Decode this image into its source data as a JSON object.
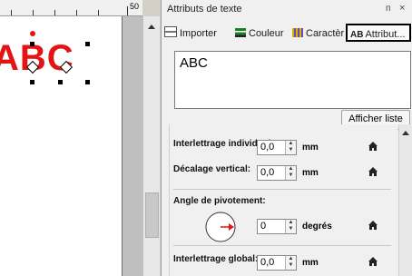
{
  "ruler": {
    "label": "50"
  },
  "canvas": {
    "text": "ABC",
    "text_color": "#e31414"
  },
  "panel": {
    "title": "Attributs de texte",
    "pin_icon": "pin-icon",
    "close_icon": "close-icon",
    "tabs": [
      {
        "label": "Importer",
        "icon": "import-icon"
      },
      {
        "label": "Couleur",
        "icon": "color-icon"
      },
      {
        "label": "Caractèr",
        "icon": "character-icon"
      },
      {
        "label": "Attribut...",
        "icon": "attribute-icon",
        "badge": "AB"
      }
    ],
    "text_value": "ABC",
    "show_list_button": "Afficher liste"
  },
  "attributes": {
    "letter_spacing_individual": {
      "label": "Interlettrage individuel:",
      "value": "0,0",
      "unit": "mm"
    },
    "vertical_offset": {
      "label": "Décalage vertical:",
      "value": "0,0",
      "unit": "mm"
    },
    "rotation_angle": {
      "label": "Angle de pivotement:",
      "value": "0",
      "unit": "degrés"
    },
    "letter_spacing_global": {
      "label": "Interlettrage global:",
      "value": "0,0",
      "unit": "mm"
    }
  },
  "colors": {
    "accent_red": "#e31414",
    "panel_bg": "#f0f0f0"
  }
}
